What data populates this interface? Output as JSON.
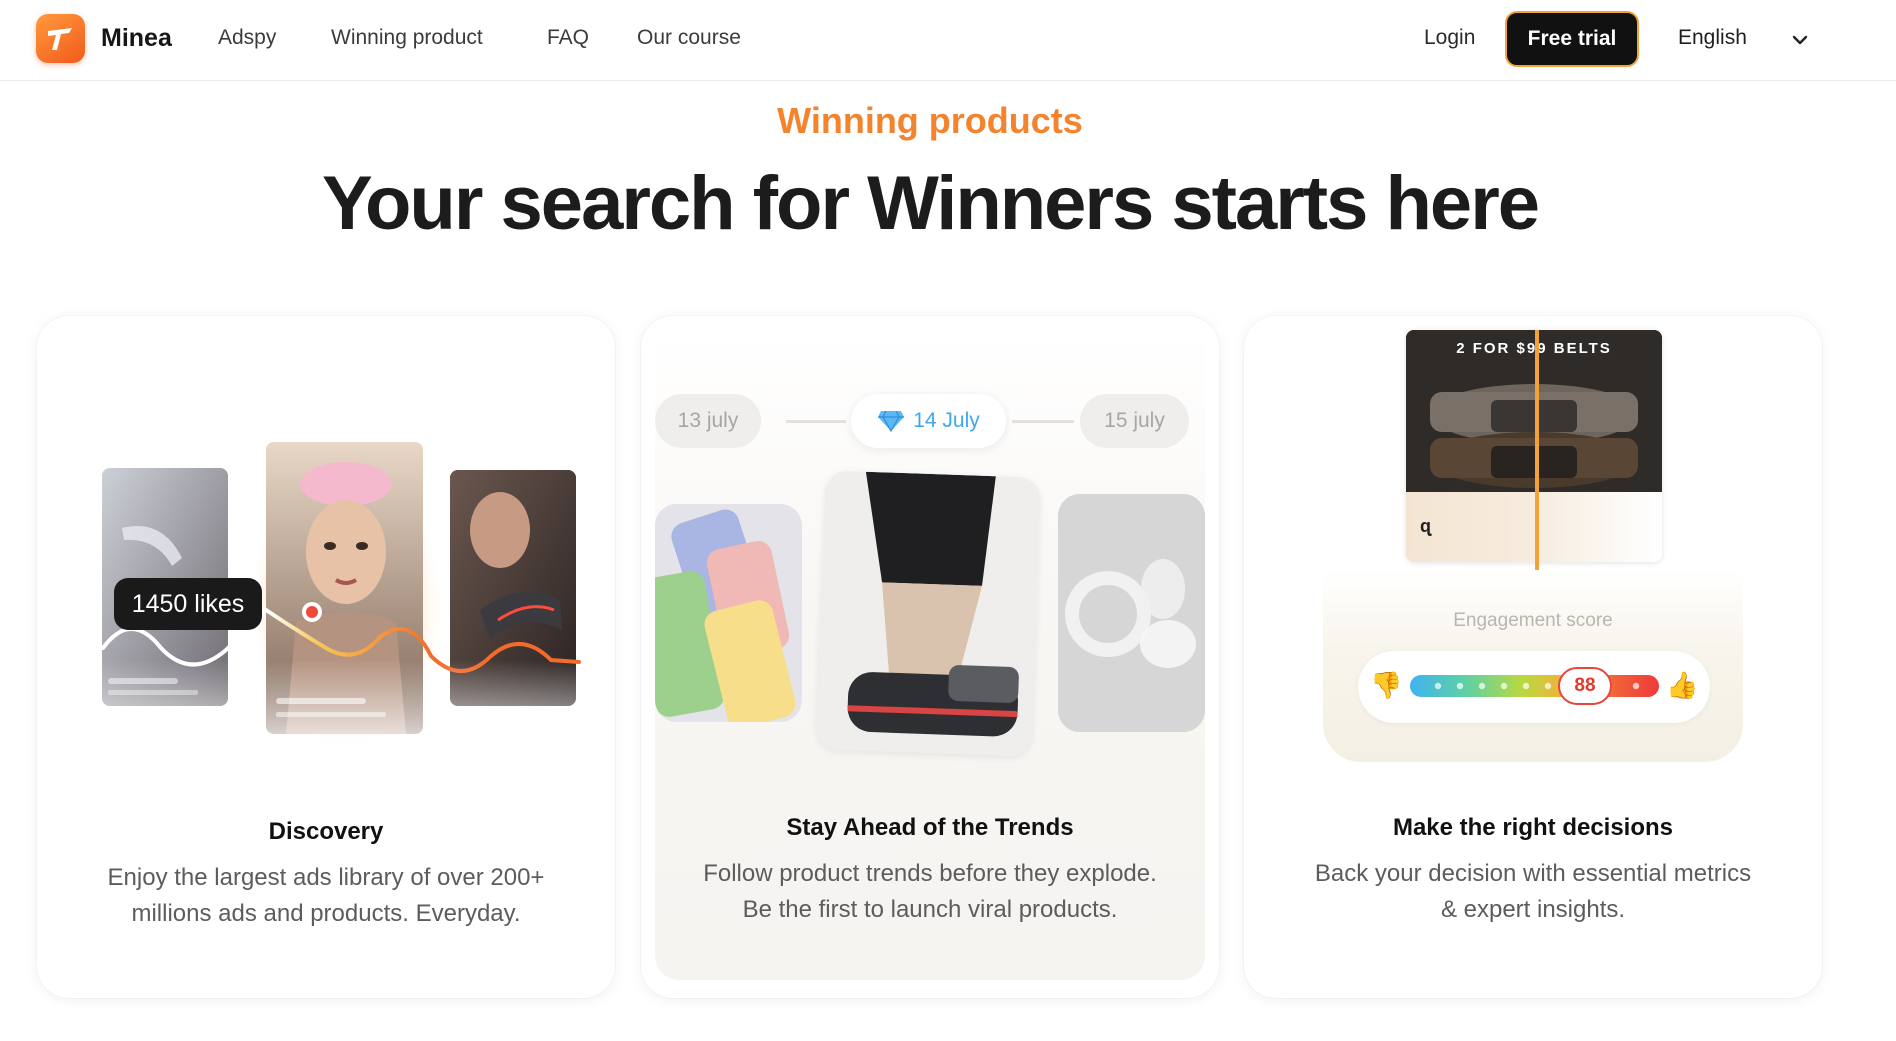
{
  "nav": {
    "brand": "Minea",
    "links": [
      "Adspy",
      "Winning product",
      "FAQ",
      "Our course"
    ],
    "login": "Login",
    "cta": "Free trial",
    "language": "English"
  },
  "hero": {
    "eyebrow": "Winning products",
    "headline": "Your search for Winners starts here"
  },
  "cards": [
    {
      "title": "Discovery",
      "description_line1": "Enjoy the largest ads library of over 200+",
      "description_line2": "millions ads and products. Everyday.",
      "likes_badge": "1450 likes"
    },
    {
      "title": "Stay Ahead of the Trends",
      "description_line1": "Follow product trends before they explode.",
      "description_line2": "Be the first to launch viral products.",
      "dates": [
        "13 july",
        "14 July",
        "15 july"
      ]
    },
    {
      "title": "Make the right decisions",
      "description_line1": "Back your decision with essential metrics",
      "description_line2": "& expert insights.",
      "ad_banner": "2 FOR $99 BELTS",
      "engagement_label": "Engagement score",
      "engagement_score": "88"
    }
  ],
  "colors": {
    "accent": "#f3832c",
    "cta_border": "#f2a33a",
    "score_red": "#e9453a",
    "highlight_date": "#3fa7f0"
  },
  "icons": [
    "minea-logo-icon",
    "chevron-down-icon",
    "diamond-icon",
    "thumbs-down-icon",
    "thumbs-up-icon"
  ]
}
